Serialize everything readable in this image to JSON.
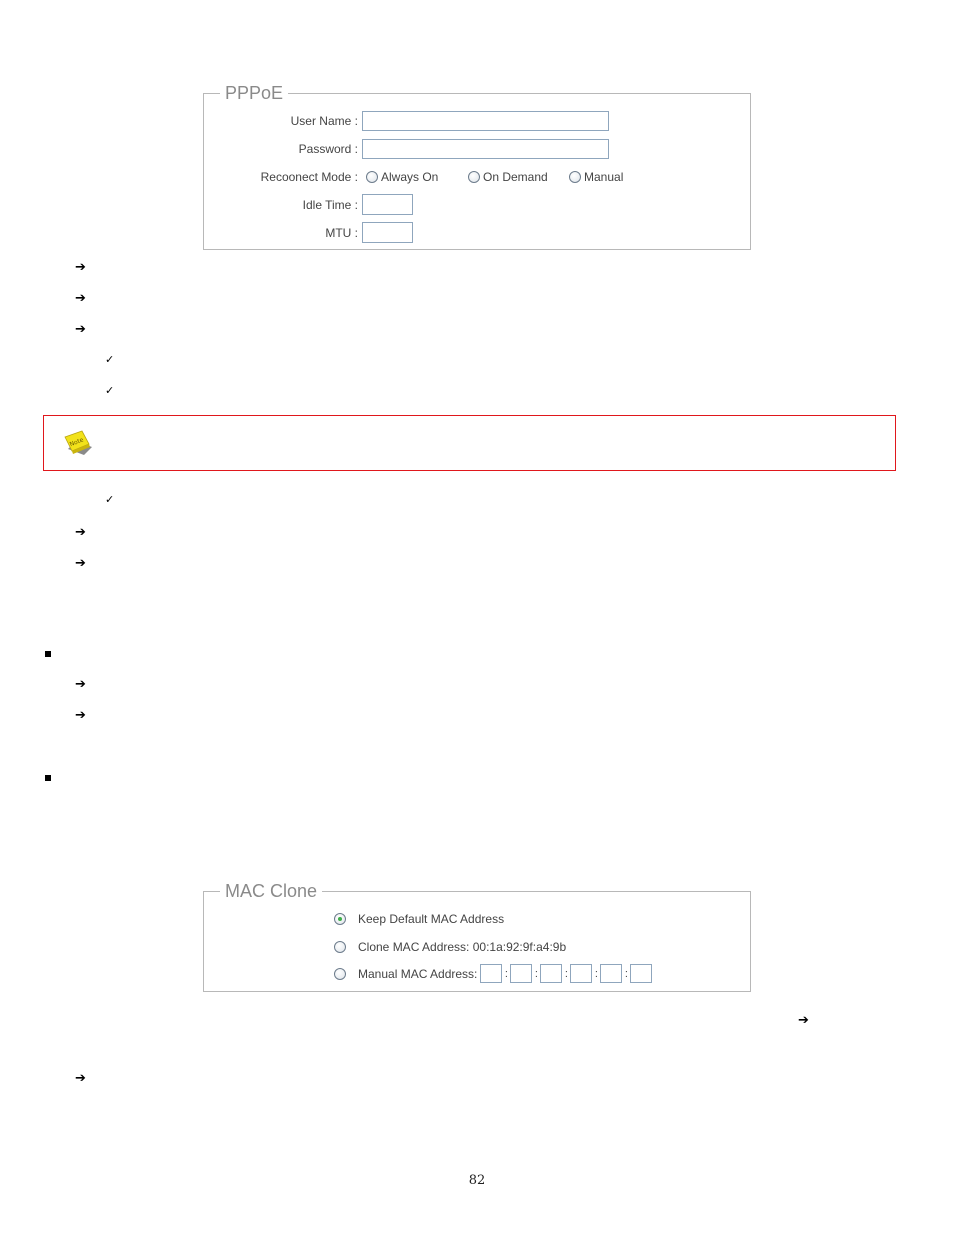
{
  "pppoe": {
    "legend": "PPPoE",
    "user_name_label": "User Name :",
    "user_name_value": "",
    "password_label": "Password :",
    "password_value": "",
    "reconnect_mode_label": "Recoonect Mode :",
    "reconnect_options": [
      {
        "label": "Always On",
        "checked": false
      },
      {
        "label": "On Demand",
        "checked": false
      },
      {
        "label": "Manual",
        "checked": false
      }
    ],
    "idle_time_label": "Idle Time :",
    "idle_time_value": "",
    "mtu_label": "MTU :",
    "mtu_value": ""
  },
  "bullets": {
    "arrow_icon": "right-arrow-icon",
    "check_icon": "check-mark-icon",
    "square_icon": "square-bullet-icon"
  },
  "note": {
    "icon": "note-icon",
    "icon_text": "Note",
    "border_color": "#e0171c"
  },
  "mac_clone": {
    "legend": "MAC Clone",
    "options": [
      {
        "label": "Keep Default MAC Address",
        "checked": true
      },
      {
        "label": "Clone MAC Address: 00:1a:92:9f:a4:9b",
        "checked": false
      },
      {
        "label": "Manual MAC Address:",
        "checked": false
      }
    ],
    "manual_mac_octets": [
      "",
      "",
      "",
      "",
      "",
      ""
    ],
    "separator": ":",
    "accent_color": "#3fae4a"
  },
  "footer": {
    "page_number": "82"
  }
}
